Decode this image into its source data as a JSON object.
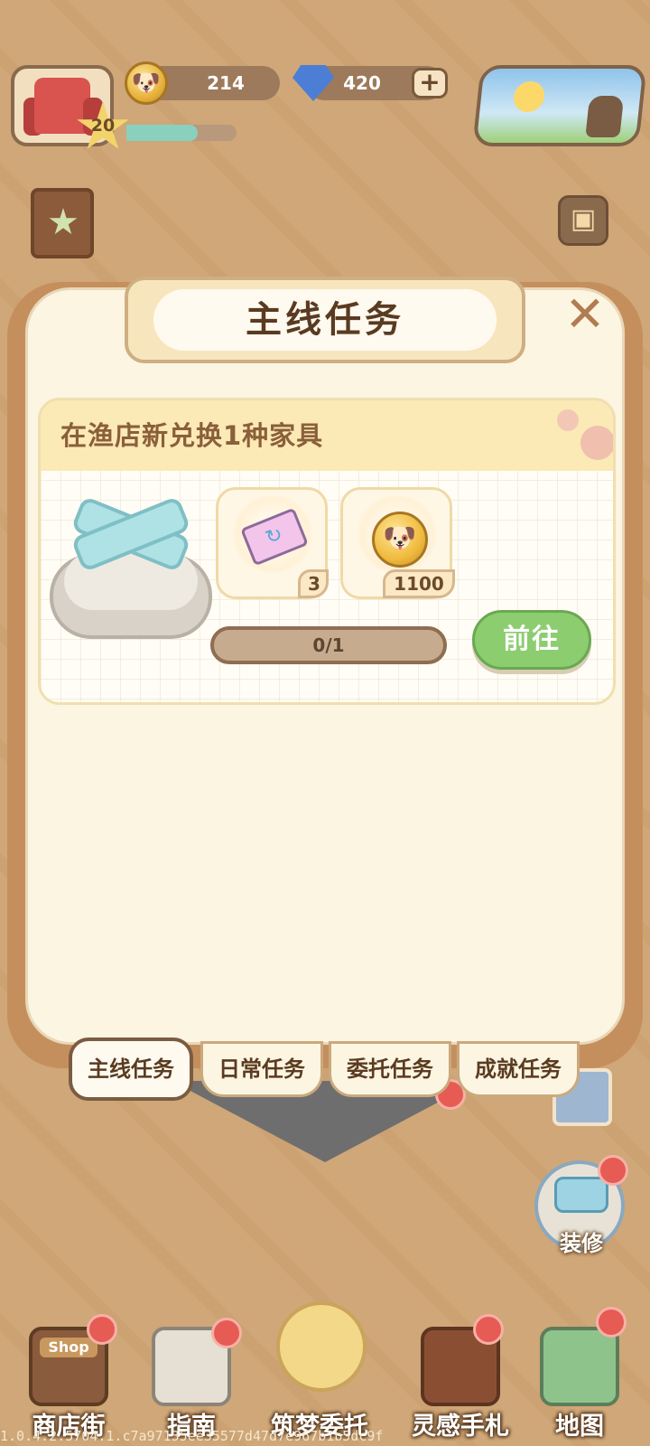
{
  "hud": {
    "level": "20",
    "xp_progress": 0.65,
    "coins": "214",
    "gems": "420",
    "plus_symbol": "+"
  },
  "modal": {
    "title": "主线任务",
    "close_symbol": "✕",
    "quest": {
      "title": "在渔店新兑换1种家具",
      "rewards": [
        {
          "icon": "ticket-icon",
          "amount": "3"
        },
        {
          "icon": "coin-icon",
          "amount": "1100"
        }
      ],
      "progress_text": "0/1",
      "progress_fraction": 0,
      "go_label": "前往"
    },
    "tabs": [
      "主线任务",
      "日常任务",
      "委托任务",
      "成就任务"
    ],
    "active_tab": 0
  },
  "decorate_label": "装修",
  "nav": [
    "商店街",
    "指南",
    "筑梦委托",
    "灵感手札",
    "地图"
  ],
  "shop_sign": "Shop",
  "version": "1.0.4.2.5704.1.c7a97135ee35577d47d7e967b1b5dc9f",
  "colors": {
    "background": "#cfa778",
    "go_button": "#8ccd70",
    "title_text": "#5a3b21",
    "notification": "#e75b55"
  }
}
